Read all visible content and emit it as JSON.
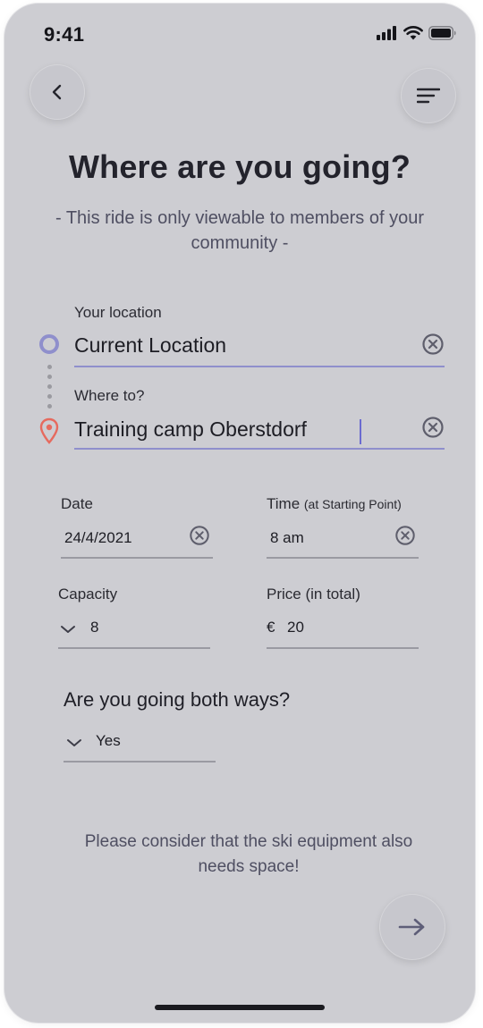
{
  "status_bar": {
    "time": "9:41"
  },
  "page": {
    "title": "Where are you going?",
    "subtitle": "- This ride is only viewable to members of your community -"
  },
  "from": {
    "label": "Your location",
    "value": "Current Location"
  },
  "to": {
    "label": "Where to?",
    "value": "Training camp Oberstdorf"
  },
  "date": {
    "label": "Date",
    "value": "24/4/2021"
  },
  "time": {
    "label": "Time",
    "hint": "(at Starting Point)",
    "value": "8 am"
  },
  "capacity": {
    "label": "Capacity",
    "value": "8"
  },
  "price": {
    "label": "Price (in total)",
    "currency": "€",
    "value": "20"
  },
  "both_ways": {
    "question": "Are you going both ways?",
    "value": "Yes"
  },
  "note": "Please consider that the ski equipment also needs space!",
  "icons": {
    "back": "chevron-left-icon",
    "menu": "filter-menu-icon",
    "next": "arrow-right-icon",
    "origin": "location-ring-icon",
    "destination": "map-pin-icon",
    "clear": "clear-circle-icon",
    "dropdown": "chevron-down-icon"
  },
  "colors": {
    "background": "#cdcdd2",
    "accent": "#8f8fcc",
    "pin": "#e66a5e",
    "text": "#1d1d24"
  }
}
